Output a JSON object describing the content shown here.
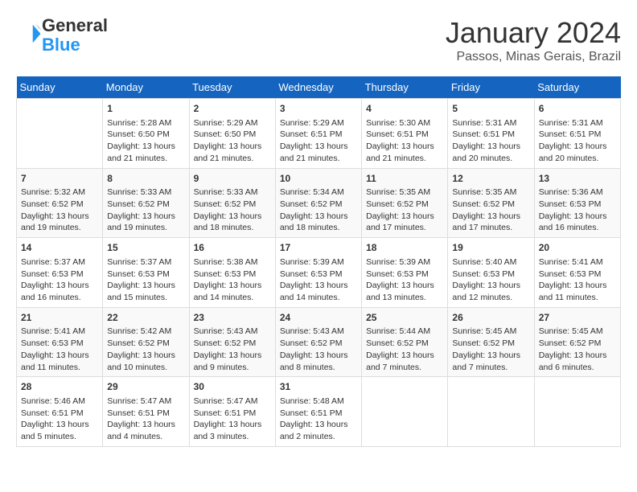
{
  "header": {
    "logo": {
      "line1": "General",
      "line2": "Blue"
    },
    "title": "January 2024",
    "location": "Passos, Minas Gerais, Brazil"
  },
  "weekdays": [
    "Sunday",
    "Monday",
    "Tuesday",
    "Wednesday",
    "Thursday",
    "Friday",
    "Saturday"
  ],
  "weeks": [
    [
      {
        "day": "",
        "info": ""
      },
      {
        "day": "1",
        "info": "Sunrise: 5:28 AM\nSunset: 6:50 PM\nDaylight: 13 hours\nand 21 minutes."
      },
      {
        "day": "2",
        "info": "Sunrise: 5:29 AM\nSunset: 6:50 PM\nDaylight: 13 hours\nand 21 minutes."
      },
      {
        "day": "3",
        "info": "Sunrise: 5:29 AM\nSunset: 6:51 PM\nDaylight: 13 hours\nand 21 minutes."
      },
      {
        "day": "4",
        "info": "Sunrise: 5:30 AM\nSunset: 6:51 PM\nDaylight: 13 hours\nand 21 minutes."
      },
      {
        "day": "5",
        "info": "Sunrise: 5:31 AM\nSunset: 6:51 PM\nDaylight: 13 hours\nand 20 minutes."
      },
      {
        "day": "6",
        "info": "Sunrise: 5:31 AM\nSunset: 6:51 PM\nDaylight: 13 hours\nand 20 minutes."
      }
    ],
    [
      {
        "day": "7",
        "info": "Sunrise: 5:32 AM\nSunset: 6:52 PM\nDaylight: 13 hours\nand 19 minutes."
      },
      {
        "day": "8",
        "info": "Sunrise: 5:33 AM\nSunset: 6:52 PM\nDaylight: 13 hours\nand 19 minutes."
      },
      {
        "day": "9",
        "info": "Sunrise: 5:33 AM\nSunset: 6:52 PM\nDaylight: 13 hours\nand 18 minutes."
      },
      {
        "day": "10",
        "info": "Sunrise: 5:34 AM\nSunset: 6:52 PM\nDaylight: 13 hours\nand 18 minutes."
      },
      {
        "day": "11",
        "info": "Sunrise: 5:35 AM\nSunset: 6:52 PM\nDaylight: 13 hours\nand 17 minutes."
      },
      {
        "day": "12",
        "info": "Sunrise: 5:35 AM\nSunset: 6:52 PM\nDaylight: 13 hours\nand 17 minutes."
      },
      {
        "day": "13",
        "info": "Sunrise: 5:36 AM\nSunset: 6:53 PM\nDaylight: 13 hours\nand 16 minutes."
      }
    ],
    [
      {
        "day": "14",
        "info": "Sunrise: 5:37 AM\nSunset: 6:53 PM\nDaylight: 13 hours\nand 16 minutes."
      },
      {
        "day": "15",
        "info": "Sunrise: 5:37 AM\nSunset: 6:53 PM\nDaylight: 13 hours\nand 15 minutes."
      },
      {
        "day": "16",
        "info": "Sunrise: 5:38 AM\nSunset: 6:53 PM\nDaylight: 13 hours\nand 14 minutes."
      },
      {
        "day": "17",
        "info": "Sunrise: 5:39 AM\nSunset: 6:53 PM\nDaylight: 13 hours\nand 14 minutes."
      },
      {
        "day": "18",
        "info": "Sunrise: 5:39 AM\nSunset: 6:53 PM\nDaylight: 13 hours\nand 13 minutes."
      },
      {
        "day": "19",
        "info": "Sunrise: 5:40 AM\nSunset: 6:53 PM\nDaylight: 13 hours\nand 12 minutes."
      },
      {
        "day": "20",
        "info": "Sunrise: 5:41 AM\nSunset: 6:53 PM\nDaylight: 13 hours\nand 11 minutes."
      }
    ],
    [
      {
        "day": "21",
        "info": "Sunrise: 5:41 AM\nSunset: 6:53 PM\nDaylight: 13 hours\nand 11 minutes."
      },
      {
        "day": "22",
        "info": "Sunrise: 5:42 AM\nSunset: 6:52 PM\nDaylight: 13 hours\nand 10 minutes."
      },
      {
        "day": "23",
        "info": "Sunrise: 5:43 AM\nSunset: 6:52 PM\nDaylight: 13 hours\nand 9 minutes."
      },
      {
        "day": "24",
        "info": "Sunrise: 5:43 AM\nSunset: 6:52 PM\nDaylight: 13 hours\nand 8 minutes."
      },
      {
        "day": "25",
        "info": "Sunrise: 5:44 AM\nSunset: 6:52 PM\nDaylight: 13 hours\nand 7 minutes."
      },
      {
        "day": "26",
        "info": "Sunrise: 5:45 AM\nSunset: 6:52 PM\nDaylight: 13 hours\nand 7 minutes."
      },
      {
        "day": "27",
        "info": "Sunrise: 5:45 AM\nSunset: 6:52 PM\nDaylight: 13 hours\nand 6 minutes."
      }
    ],
    [
      {
        "day": "28",
        "info": "Sunrise: 5:46 AM\nSunset: 6:51 PM\nDaylight: 13 hours\nand 5 minutes."
      },
      {
        "day": "29",
        "info": "Sunrise: 5:47 AM\nSunset: 6:51 PM\nDaylight: 13 hours\nand 4 minutes."
      },
      {
        "day": "30",
        "info": "Sunrise: 5:47 AM\nSunset: 6:51 PM\nDaylight: 13 hours\nand 3 minutes."
      },
      {
        "day": "31",
        "info": "Sunrise: 5:48 AM\nSunset: 6:51 PM\nDaylight: 13 hours\nand 2 minutes."
      },
      {
        "day": "",
        "info": ""
      },
      {
        "day": "",
        "info": ""
      },
      {
        "day": "",
        "info": ""
      }
    ]
  ]
}
